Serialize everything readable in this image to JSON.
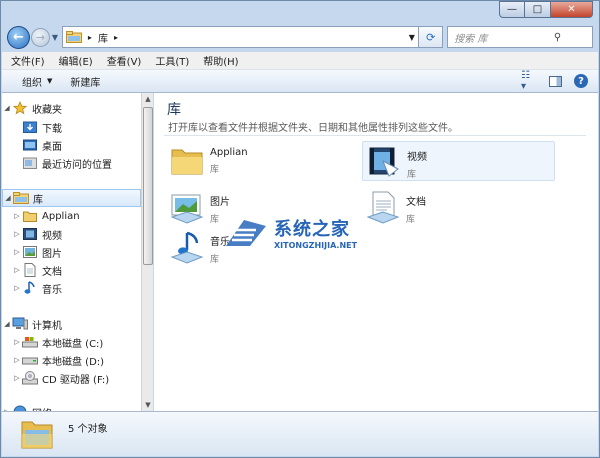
{
  "window": {
    "caption": {
      "minimize": "—",
      "maximize": "□",
      "close": "✕"
    }
  },
  "nav": {
    "back_label": "←",
    "forward_label": "→",
    "address": {
      "crumb": "库",
      "separator": "▸"
    },
    "refresh_label": "⟳",
    "search_placeholder": "搜索 库"
  },
  "menu": [
    "文件(F)",
    "编辑(E)",
    "查看(V)",
    "工具(T)",
    "帮助(H)"
  ],
  "toolbar": {
    "organize": "组织",
    "new_library": "新建库"
  },
  "tree": {
    "favorites": {
      "label": "收藏夹",
      "items": [
        "下载",
        "桌面",
        "最近访问的位置"
      ]
    },
    "libraries": {
      "label": "库",
      "items": [
        "Applian",
        "视频",
        "图片",
        "文档",
        "音乐"
      ]
    },
    "computer": {
      "label": "计算机",
      "items": [
        "本地磁盘 (C:)",
        "本地磁盘 (D:)",
        "CD 驱动器 (F:)"
      ]
    },
    "network": {
      "label": "网络"
    }
  },
  "content": {
    "title": "库",
    "description": "打开库以查看文件并根据文件夹、日期和其他属性排列这些文件。",
    "libraries": [
      {
        "name": "Applian",
        "type": "库",
        "icon": "folder-icon"
      },
      {
        "name": "视频",
        "type": "库",
        "icon": "video-library-icon"
      },
      {
        "name": "图片",
        "type": "库",
        "icon": "picture-library-icon"
      },
      {
        "name": "文档",
        "type": "库",
        "icon": "document-library-icon"
      },
      {
        "name": "音乐",
        "type": "库",
        "icon": "music-library-icon"
      }
    ]
  },
  "watermark": {
    "cn": "系统之家",
    "en": "XITONGZHIJIA.NET"
  },
  "details": {
    "count": "5 个对象"
  },
  "colors": {
    "accent": "#2766b7",
    "selection": "#d9e9fb"
  }
}
